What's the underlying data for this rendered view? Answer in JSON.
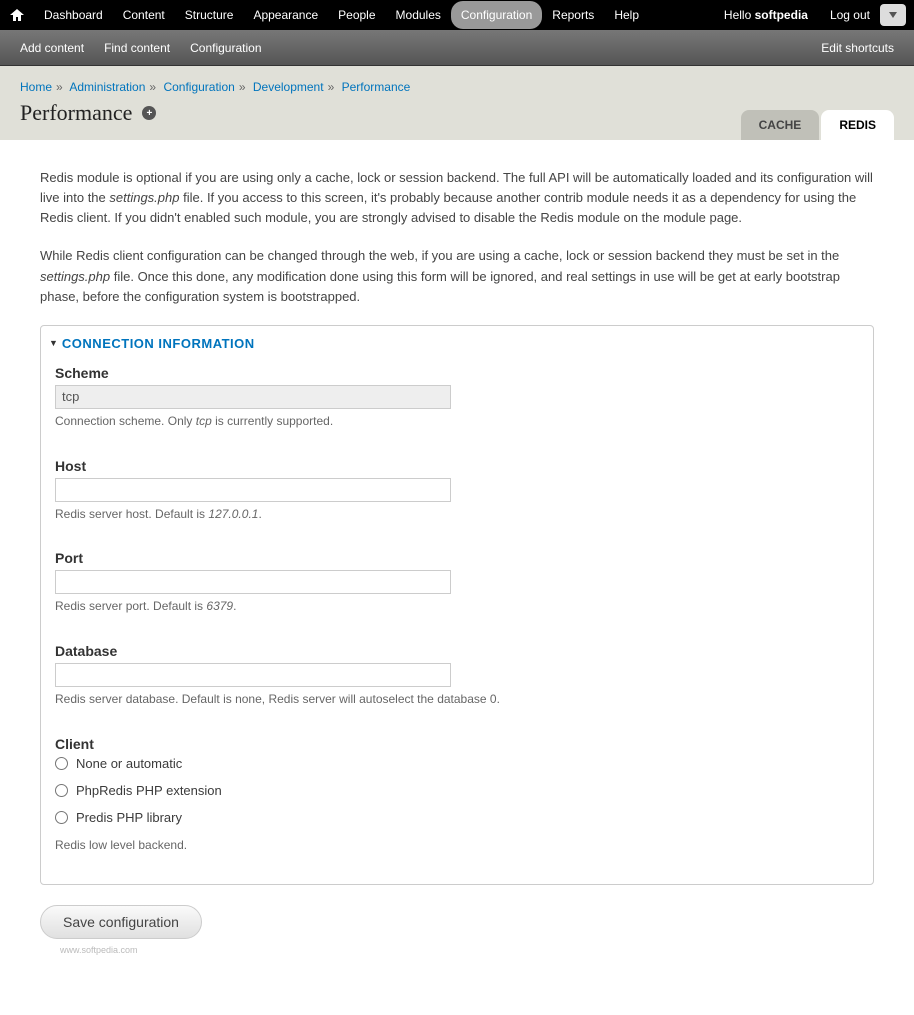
{
  "toolbar": {
    "items": [
      "Dashboard",
      "Content",
      "Structure",
      "Appearance",
      "People",
      "Modules",
      "Configuration",
      "Reports",
      "Help"
    ],
    "active": "Configuration",
    "hello_prefix": "Hello ",
    "hello_user": "softpedia",
    "logout": "Log out"
  },
  "shortcuts": {
    "items": [
      "Add content",
      "Find content",
      "Configuration"
    ],
    "edit": "Edit shortcuts"
  },
  "breadcrumb": [
    "Home",
    "Administration",
    "Configuration",
    "Development",
    "Performance"
  ],
  "page_title": "Performance",
  "tabs": {
    "cache": "CACHE",
    "redis": "REDIS"
  },
  "intro": {
    "p1_a": "Redis module is optional if you are using only a cache, lock or session backend. The full API will be automatically loaded and its configuration will live into the ",
    "p1_em": "settings.php",
    "p1_b": " file. If you access to this screen, it's probably because another contrib module needs it as a dependency for using the Redis client. If you didn't enabled such module, you are strongly advised to disable the Redis module on the module page.",
    "p2_a": "While Redis client configuration can be changed through the web, if you are using a cache, lock or session backend they must be set in the ",
    "p2_em": "settings.php",
    "p2_b": " file. Once this done, any modification done using this form will be ignored, and real settings in use will be get at early bootstrap phase, before the configuration system is bootstrapped."
  },
  "fieldset_title": "CONNECTION INFORMATION",
  "fields": {
    "scheme": {
      "label": "Scheme",
      "value": "tcp",
      "desc_a": "Connection scheme. Only ",
      "desc_em": "tcp",
      "desc_b": " is currently supported."
    },
    "host": {
      "label": "Host",
      "value": "",
      "desc_a": "Redis server host. Default is ",
      "desc_em": "127.0.0.1",
      "desc_b": "."
    },
    "port": {
      "label": "Port",
      "value": "",
      "desc_a": "Redis server port. Default is ",
      "desc_em": "6379",
      "desc_b": "."
    },
    "database": {
      "label": "Database",
      "value": "",
      "desc": "Redis server database. Default is none, Redis server will autoselect the database 0."
    },
    "client": {
      "label": "Client",
      "options": [
        "None or automatic",
        "PhpRedis PHP extension",
        "Predis PHP library"
      ],
      "desc": "Redis low level backend."
    }
  },
  "submit": "Save configuration",
  "watermark": "www.softpedia.com"
}
